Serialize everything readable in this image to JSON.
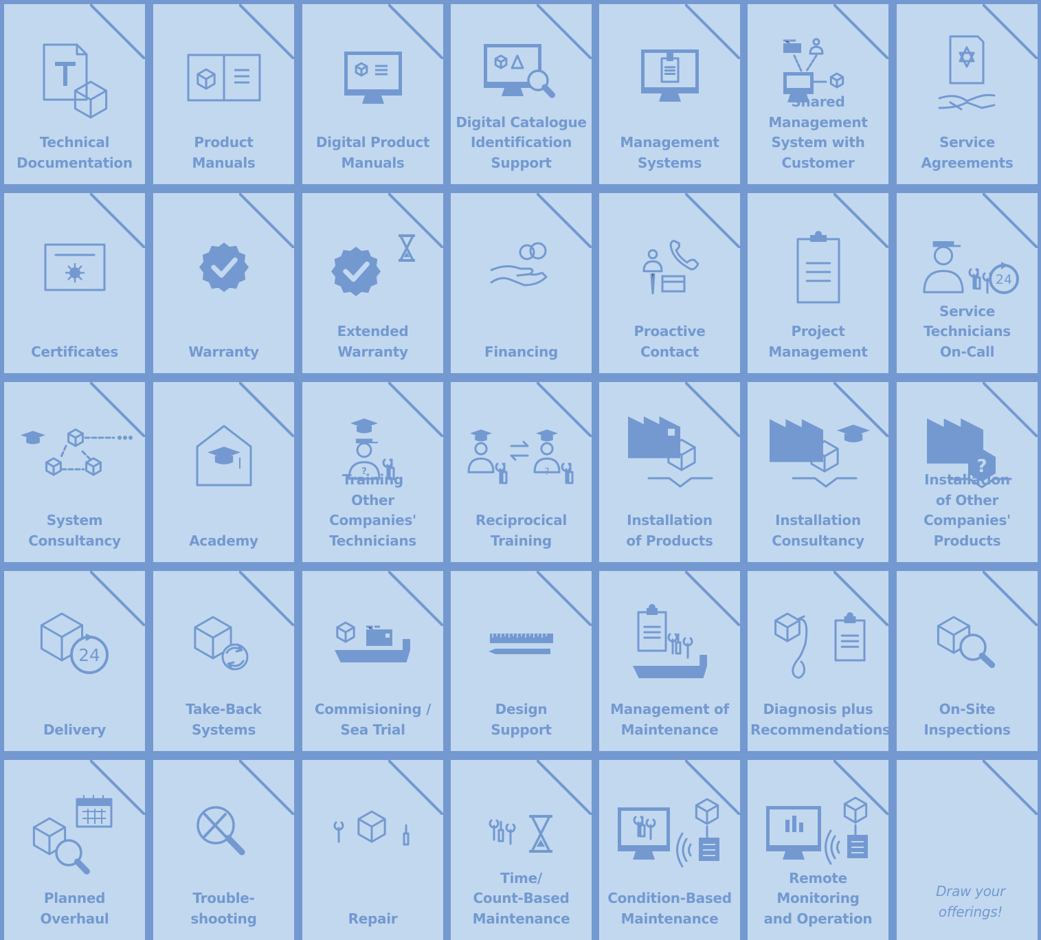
{
  "colors": {
    "background": "#7399d0",
    "card": "#c2d8ef",
    "accent": "#7399d0"
  },
  "tiles": [
    {
      "label": "Technical\nDocumentation",
      "icon": "document-cube-icon"
    },
    {
      "label": "Product\nManuals",
      "icon": "open-book-icon"
    },
    {
      "label": "Digital  Product\nManuals",
      "icon": "monitor-manual-icon"
    },
    {
      "label": "Digital Catalogue\nIdentification\nSupport",
      "icon": "monitor-search-icon"
    },
    {
      "label": "Management\nSystems",
      "icon": "monitor-clipboard-icon"
    },
    {
      "label": "Shared\nManagement\nSystem with\nCustomer",
      "icon": "shared-network-icon"
    },
    {
      "label": "Service\nAgreements",
      "icon": "handshake-icon"
    },
    {
      "label": "Certificates",
      "icon": "certificate-icon"
    },
    {
      "label": "Warranty",
      "icon": "verified-badge-icon"
    },
    {
      "label": "Extended\nWarranty",
      "icon": "badge-hourglass-icon"
    },
    {
      "label": "Financing",
      "icon": "hand-coins-icon"
    },
    {
      "label": "Proactive\nContact",
      "icon": "person-phone-icon"
    },
    {
      "label": "Project\nManagement",
      "icon": "clipboard-icon"
    },
    {
      "label": "Service\nTechnicians\nOn-Call",
      "icon": "technician-24h-icon"
    },
    {
      "label": "System\nConsultancy",
      "icon": "cube-network-icon"
    },
    {
      "label": "Academy",
      "icon": "academy-house-icon"
    },
    {
      "label": "Training\nOther\nCompanies'\nTechnicians",
      "icon": "trainer-icon"
    },
    {
      "label": "Reciprocical\nTraining",
      "icon": "exchange-trainers-icon"
    },
    {
      "label": "Installation\nof Products",
      "icon": "factory-cube-icon"
    },
    {
      "label": "Installation\nConsultancy",
      "icon": "factory-graduate-icon"
    },
    {
      "label": "Installation\nof Other\nCompanies'\nProducts",
      "icon": "factory-question-icon"
    },
    {
      "label": "Delivery",
      "icon": "cube-24h-icon"
    },
    {
      "label": "Take-Back\nSystems",
      "icon": "cube-recycle-icon"
    },
    {
      "label": "Commisioning /\nSea Trial",
      "icon": "ship-cube-icon"
    },
    {
      "label": "Design\nSupport",
      "icon": "ruler-pencil-icon"
    },
    {
      "label": "Management of\nMaintenance",
      "icon": "ship-clipboard-tools-icon"
    },
    {
      "label": "Diagnosis plus\nRecommendations",
      "icon": "stethoscope-icon"
    },
    {
      "label": "On-Site\nInspections",
      "icon": "cube-magnifier-icon"
    },
    {
      "label": "Planned\nOverhaul",
      "icon": "calendar-inspection-icon"
    },
    {
      "label": "Trouble-\nshooting",
      "icon": "magnifier-x-icon"
    },
    {
      "label": "Repair",
      "icon": "cube-tools-icon"
    },
    {
      "label": "Time/\nCount-Based\nMaintenance",
      "icon": "tools-hourglass-icon"
    },
    {
      "label": "Condition-Based\nMaintenance",
      "icon": "monitor-sensor-icon"
    },
    {
      "label": "Remote\nMonitoring\nand Operation",
      "icon": "remote-monitor-icon"
    },
    {
      "label": "Draw your\nofferings!",
      "icon": "",
      "note": true
    }
  ]
}
